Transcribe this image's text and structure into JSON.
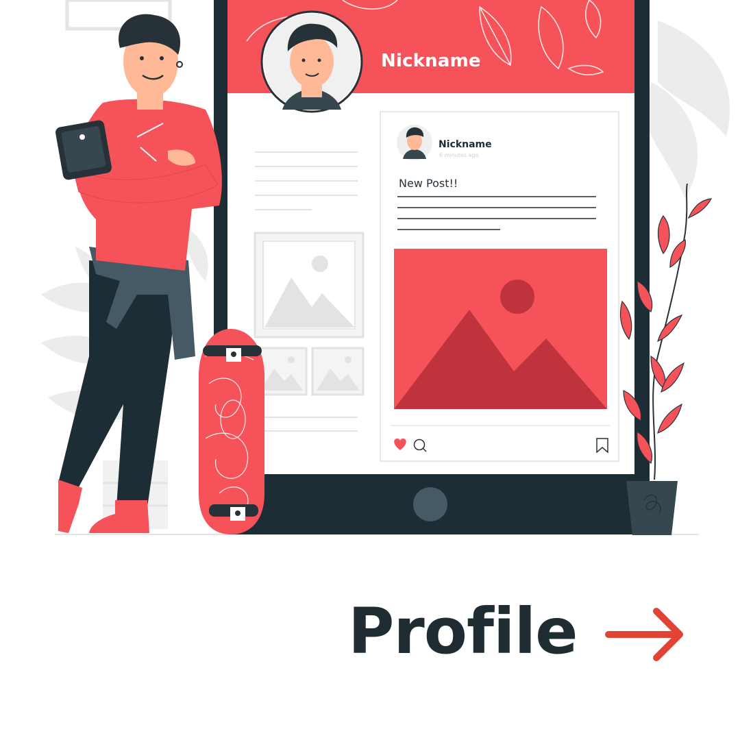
{
  "profile": {
    "header_name": "Nickname"
  },
  "post": {
    "author": "Nickname",
    "time": "6 minutes ago",
    "text": "New Post!!",
    "actions": {
      "like_icon": "heart-icon",
      "comment_icon": "comment-icon",
      "save_icon": "bookmark-icon"
    }
  },
  "cta": {
    "title": "Profile",
    "arrow_icon": "arrow-right-icon"
  },
  "colors": {
    "accent": "#f5525a",
    "dark": "#1d2d35",
    "arrow": "#e14434"
  }
}
